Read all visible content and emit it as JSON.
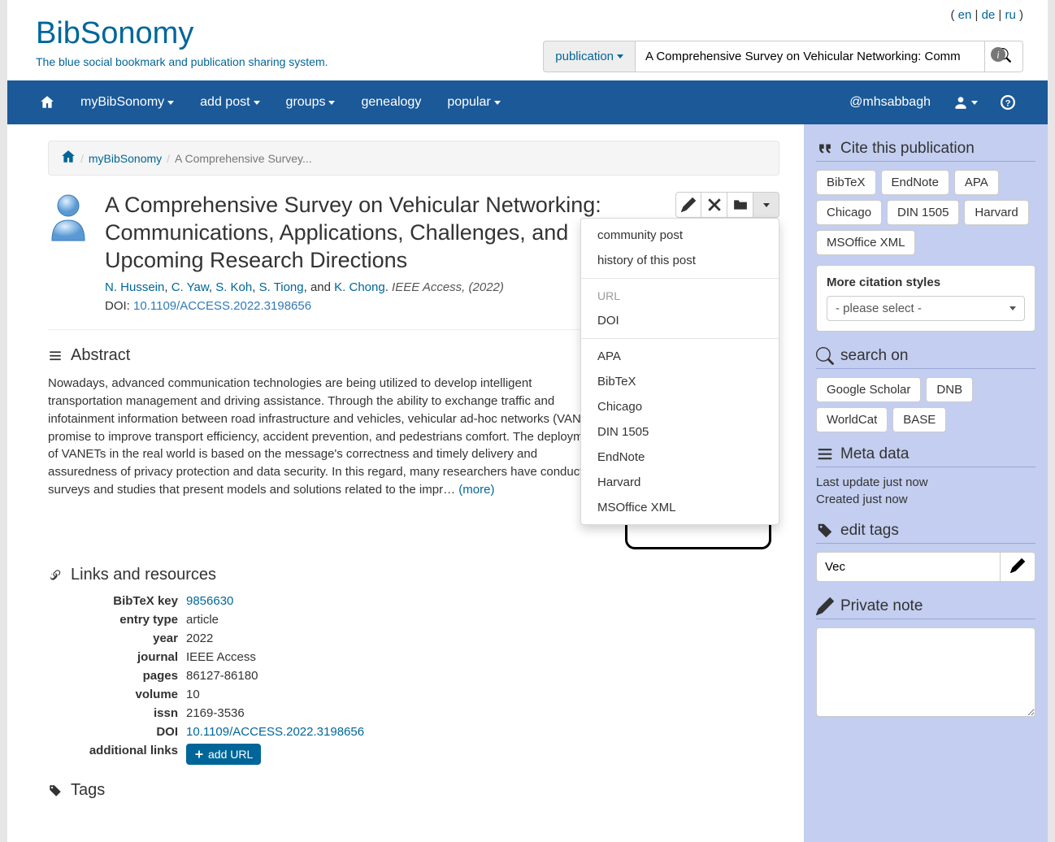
{
  "lang": {
    "open": "(",
    "en": "en",
    "de": "de",
    "ru": "ru",
    "sep": " | ",
    "close": ")"
  },
  "brand": {
    "title": "BibSonomy",
    "tagline": "The blue social bookmark and publication sharing system."
  },
  "search": {
    "type_label": "publication",
    "value": "A Comprehensive Survey on Vehicular Networking: Communications"
  },
  "nav": {
    "items": [
      "myBibSonomy",
      "add post",
      "groups",
      "genealogy",
      "popular"
    ],
    "username": "@mhsabbagh"
  },
  "breadcrumb": {
    "my": "myBibSonomy",
    "current": "A Comprehensive Survey..."
  },
  "pub": {
    "title": "A Comprehensive Survey on Vehicular Networking: Communications, Applications, Challenges, and Upcoming Research Directions",
    "authors": [
      "N. Hussein",
      "C. Yaw",
      "S. Koh",
      "S. Tiong"
    ],
    "and": ", and ",
    "last_author": "K. Chong",
    "meta_journal": "IEEE Access,",
    "meta_year": "2022",
    "doi_label": "DOI:",
    "doi": "10.1109/ACCESS.2022.3198656"
  },
  "dropdown": {
    "community": "community post",
    "history": "history of this post",
    "url_header": "URL",
    "doi": "DOI",
    "formats": [
      "APA",
      "BibTeX",
      "Chicago",
      "DIN 1505",
      "EndNote",
      "Harvard",
      "MSOffice XML"
    ]
  },
  "abstract": {
    "header": "Abstract",
    "text": "Nowadays, advanced communication technologies are being utilized to develop intelligent transportation management and driving assistance. Through the ability to exchange traffic and infotainment information between road infrastructure and vehicles, vehicular ad-hoc networks (VANETs) promise to improve transport efficiency, accident prevention, and pedestrians comfort. The deployment of VANETs in the real world is based on the message's correctness and timely delivery and assuredness of privacy protection and data security. In this regard, many researchers have conducted surveys and studies that present models and solutions related to the impr… ",
    "more": "(more)"
  },
  "links": {
    "header": "Links and resources",
    "rows": {
      "bibtex_key_label": "BibTeX key",
      "bibtex_key": "9856630",
      "entry_type_label": "entry type",
      "entry_type": "article",
      "year_label": "year",
      "year": "2022",
      "journal_label": "journal",
      "journal": "IEEE Access",
      "pages_label": "pages",
      "pages": "86127-86180",
      "volume_label": "volume",
      "volume": "10",
      "issn_label": "issn",
      "issn": "2169-3536",
      "doi_label": "DOI",
      "doi": "10.1109/ACCESS.2022.3198656",
      "addl_label": "additional links",
      "add_url": "add URL"
    }
  },
  "tags": {
    "header": "Tags"
  },
  "side": {
    "cite_header": "Cite this publication",
    "cite_pills": [
      "BibTeX",
      "EndNote",
      "APA",
      "Chicago",
      "DIN 1505",
      "Harvard",
      "MSOffice XML"
    ],
    "more_styles": "More citation styles",
    "select_placeholder": "- please select -",
    "search_header": "search on",
    "search_pills": [
      "Google Scholar",
      "DNB",
      "WorldCat",
      "BASE"
    ],
    "meta_header": "Meta data",
    "meta_update": "Last update just now",
    "meta_created": "Created just now",
    "edit_tags_header": "edit tags",
    "tag_value": "Vec",
    "private_note_header": "Private note"
  }
}
